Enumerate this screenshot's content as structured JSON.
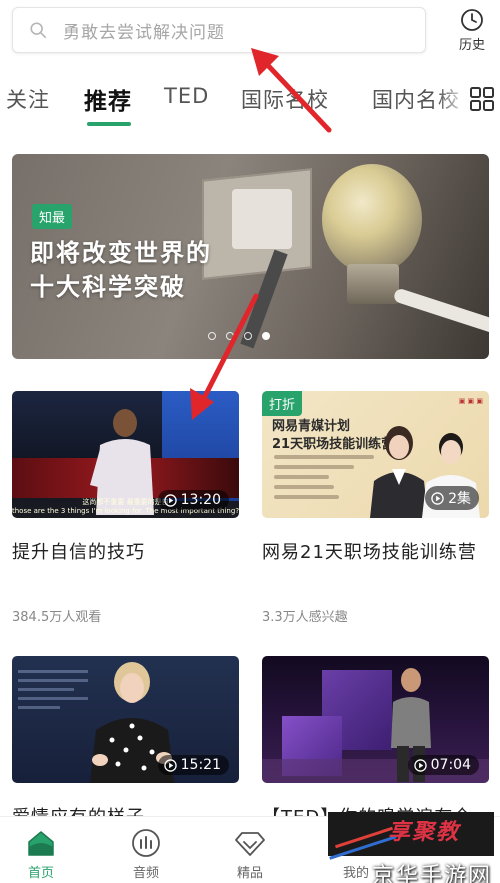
{
  "search": {
    "placeholder": "勇敢去尝试解决问题"
  },
  "history": {
    "label": "历史"
  },
  "tabs": [
    {
      "label": "关注"
    },
    {
      "label": "推荐"
    },
    {
      "label": "TED"
    },
    {
      "label": "国际名校"
    },
    {
      "label": "国内名校"
    }
  ],
  "banner": {
    "tag": "知最",
    "title_line1": "即将改变世界的",
    "title_line2": "十大科学突破",
    "slides": 4,
    "active_slide": 4
  },
  "cards": [
    {
      "title": "提升自信的技巧",
      "meta": "384.5万人观看",
      "duration": "13:20",
      "subtitle_cn": "这尚都不重要 最重要的是自",
      "subtitle_en": "those are the 3 things I'm looking for. The most important thing? Self-confidence."
    },
    {
      "title": "网易21天职场技能训练营",
      "meta": "3.3万人感兴趣",
      "duration": "2集",
      "tag": "打折",
      "thumb_h1": "网易青媒计划",
      "thumb_h2": "21天职场技能训练营"
    },
    {
      "title": "爱情应有的样子",
      "duration": "15:21"
    },
    {
      "title": "【TED】你的鳴学遍存全",
      "duration": "07:04"
    }
  ],
  "bottom_nav": [
    {
      "label": "首页",
      "icon": "home-icon"
    },
    {
      "label": "音频",
      "icon": "audio-icon"
    },
    {
      "label": "精品",
      "icon": "diamond-icon"
    },
    {
      "label": "我的",
      "icon": "profile-icon"
    }
  ],
  "watermark": {
    "logo": "享聚教",
    "text": "京华手游网"
  },
  "colors": {
    "accent": "#27a36b",
    "annotation_arrow": "#e0262b"
  }
}
